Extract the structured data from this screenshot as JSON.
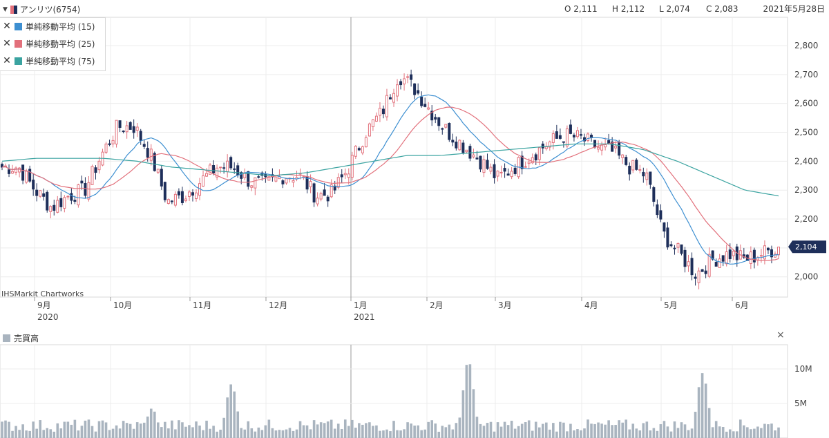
{
  "header": {
    "symbol_label": "アンリツ(6754)",
    "open_label": "O 2,111",
    "high_label": "H 2,112",
    "low_label": "L 2,074",
    "close_label": "C 2,083",
    "date_label": "2021年5月28日"
  },
  "legend": {
    "items": [
      {
        "label": "単純移動平均 (15)",
        "color": "#3d8fd1"
      },
      {
        "label": "単純移動平均 (25)",
        "color": "#e2707b"
      },
      {
        "label": "単純移動平均 (75)",
        "color": "#3aa3a0"
      }
    ]
  },
  "credit": "IHSMarkit Chartworks",
  "last_price_label": "2,104",
  "volume_panel": {
    "title": "売買高",
    "close_glyph": "×"
  },
  "colors": {
    "up": "#e2707b",
    "down": "#1e2f5a",
    "ma15": "#3d8fd1",
    "ma25": "#e2707b",
    "ma75": "#3aa3a0",
    "volume": "#a9b4bf",
    "badge": "#1e2f5a"
  },
  "chart_data": [
    {
      "type": "candlestick",
      "title": "アンリツ(6754)",
      "y_ticks": [
        2000,
        2100,
        2200,
        2300,
        2400,
        2500,
        2600,
        2700,
        2800
      ],
      "y_tick_labels": [
        "2,000",
        "",
        "2,200",
        "2,300",
        "2,400",
        "2,500",
        "2,600",
        "2,700",
        "2,800"
      ],
      "x_tick_labels": [
        "9月",
        "10月",
        "11月",
        "12月",
        "1月",
        "2月",
        "3月",
        "4月",
        "5月",
        "6月"
      ],
      "x_year_labels": [
        {
          "at": "9月",
          "label": "2020"
        },
        {
          "at": "1月",
          "label": "2021"
        }
      ],
      "ylim": [
        1930,
        2870
      ],
      "closes_weekly_approx": [
        2380,
        2380,
        2300,
        2240,
        2280,
        2300,
        2420,
        2520,
        2520,
        2420,
        2260,
        2280,
        2330,
        2380,
        2380,
        2330,
        2320,
        2350,
        2350,
        2280,
        2290,
        2380,
        2500,
        2570,
        2700,
        2650,
        2570,
        2500,
        2450,
        2400,
        2340,
        2380,
        2420,
        2460,
        2490,
        2480,
        2450,
        2430,
        2380,
        2350,
        2150,
        2080,
        2010,
        2060,
        2080,
        2060,
        2080,
        2104
      ],
      "series": [
        {
          "name": "単純移動平均 (15)"
        },
        {
          "name": "単純移動平均 (25)"
        },
        {
          "name": "単純移動平均 (75)",
          "values_weekly_approx": [
            2400,
            2410,
            2410,
            2410,
            2400,
            2380,
            2370,
            2360,
            2350,
            2360,
            2380,
            2400,
            2420,
            2420,
            2430,
            2440,
            2450,
            2460,
            2460,
            2440,
            2400,
            2350,
            2300,
            2280
          ]
        }
      ]
    },
    {
      "type": "bar",
      "title": "売買高",
      "y_ticks": [
        5000000,
        10000000
      ],
      "y_tick_labels": [
        "5M",
        "10M"
      ],
      "ylim": [
        0,
        12500000
      ],
      "peaks": [
        {
          "near": "10月",
          "value": 4300000
        },
        {
          "near": "11月",
          "value": 7800000
        },
        {
          "near": "2月",
          "value": 11200000
        },
        {
          "near": "5月",
          "value": 9400000
        }
      ]
    }
  ]
}
